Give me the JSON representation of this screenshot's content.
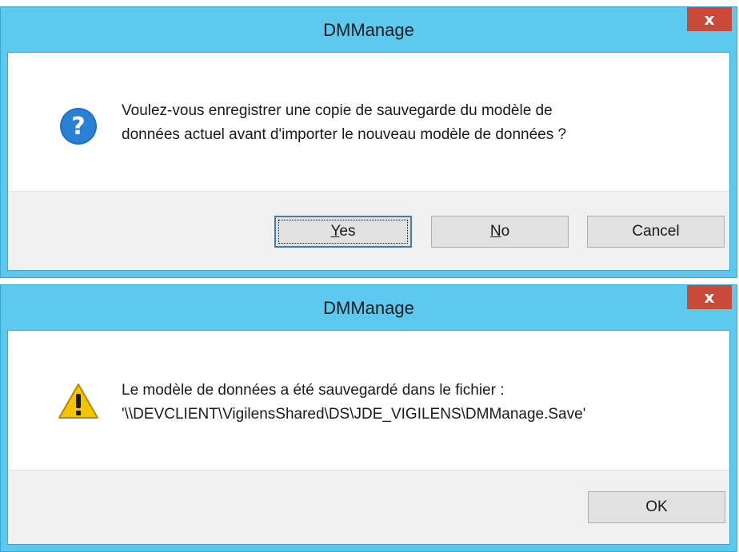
{
  "dialogs": [
    {
      "title": "DMManage",
      "close_glyph": "x",
      "icon": "question-icon",
      "message_lines": [
        "Voulez-vous enregistrer une copie de sauvegarde du modèle de",
        "données actuel avant d'importer le nouveau modèle de données ?"
      ],
      "buttons": [
        {
          "label": "Yes",
          "mnemonic": "Y",
          "rest": "es"
        },
        {
          "label": "No",
          "mnemonic": "N",
          "rest": "o"
        },
        {
          "label": "Cancel"
        }
      ]
    },
    {
      "title": "DMManage",
      "close_glyph": "x",
      "icon": "warning-icon",
      "message_lines": [
        "Le modèle de données a été sauvegardé dans le fichier :",
        "'\\\\DEVCLIENT\\VigilensShared\\DS\\JDE_VIGILENS\\DMManage.Save'"
      ],
      "buttons": [
        {
          "label": "OK"
        }
      ]
    }
  ],
  "colors": {
    "titlebar": "#5ec9ee",
    "close": "#c94a3a",
    "footer": "#f0f0f0",
    "question_icon": "#1f72c6",
    "warning_icon": "#f2c500"
  }
}
